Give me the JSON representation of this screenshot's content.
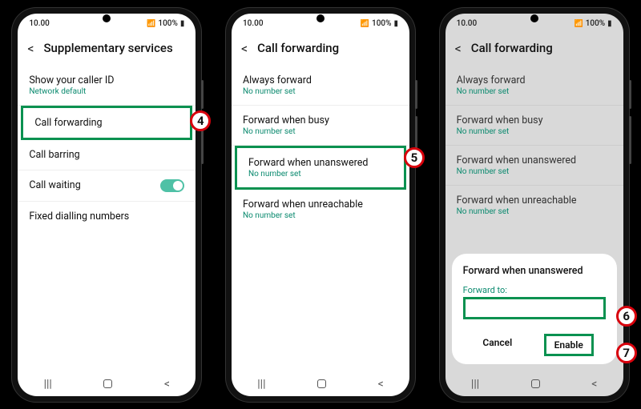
{
  "status": {
    "time": "10.00",
    "battery": "100%"
  },
  "phone1": {
    "title": "Supplementary services",
    "items": [
      {
        "title": "Show your caller ID",
        "sub": "Network default"
      },
      {
        "title": "Call forwarding"
      },
      {
        "title": "Call barring"
      },
      {
        "title": "Call waiting"
      },
      {
        "title": "Fixed dialling numbers"
      }
    ],
    "step": "4"
  },
  "phone2": {
    "title": "Call forwarding",
    "items": [
      {
        "title": "Always forward",
        "sub": "No number set"
      },
      {
        "title": "Forward when busy",
        "sub": "No number set"
      },
      {
        "title": "Forward when unanswered",
        "sub": "No number set"
      },
      {
        "title": "Forward when unreachable",
        "sub": "No number set"
      }
    ],
    "step": "5"
  },
  "phone3": {
    "title": "Call forwarding",
    "items": [
      {
        "title": "Always forward",
        "sub": "No number set"
      },
      {
        "title": "Forward when busy",
        "sub": "No number set"
      },
      {
        "title": "Forward when unanswered",
        "sub": "No number set"
      },
      {
        "title": "Forward when unreachable",
        "sub": "No number set"
      }
    ],
    "dialog": {
      "title": "Forward when unanswered",
      "label": "Forward to:",
      "cancel": "Cancel",
      "enable": "Enable"
    },
    "step6": "6",
    "step7": "7"
  }
}
